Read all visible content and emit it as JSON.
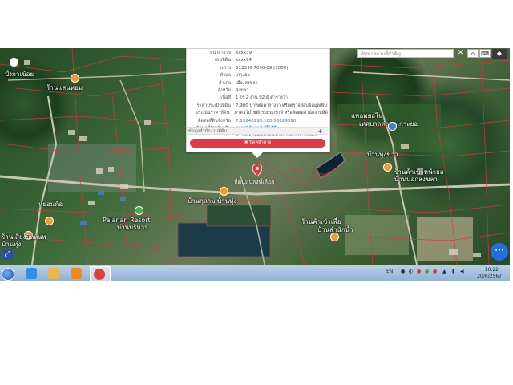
{
  "popup": {
    "rows": [
      {
        "label": "หน้าสำรวจ",
        "value": "xxxx39",
        "link": false
      },
      {
        "label": "เลขที่ดิน",
        "value": "xxxx94",
        "link": false
      },
      {
        "label": "ระวาง",
        "value": "5123 III 7090-09 (1000)",
        "link": false
      },
      {
        "label": "ตำบล",
        "value": "เกาะยอ",
        "link": false
      },
      {
        "label": "อำเภอ",
        "value": "เมืองสงขลา",
        "link": false
      },
      {
        "label": "จังหวัด",
        "value": "สงขลา",
        "link": false
      },
      {
        "label": "เนื้อที่",
        "value": "1 ไร่ 2 งาน 92.6 ตารางวา",
        "link": false
      },
      {
        "label": "ราคาประเมินที่ดิน",
        "value": "7,900 บาทต่อตารางวา หรือตรวจสอบข้อมูลเพิ่ม",
        "link": false
      },
      {
        "label": "ประเมินราคาที่ดิน",
        "value": "ภาพ เว็บไซต์กรมธนารักษ์ หรือติดต่อสำนักงานที่ดิน",
        "link": false
      },
      {
        "label": "ติดต่อที่ดินจังหวัด",
        "value": "7.15240299,100.53824990",
        "link": true
      },
      {
        "label": "ข้อมูลที่ดินเพิ่มเติม",
        "value": "ตรวจที่ดินแปลงนี้ได้ที่",
        "link": true
      },
      {
        "label": "",
        "value": "ตรวจสอบที่ตั้งแปลงที่ดินแบบสำนักงานที่ดิน",
        "link": true
      }
    ],
    "more_label": "ข้อมูลสำนักงานที่ดิน",
    "more_icon": "+",
    "close_label": "✖ ปิดหน้าต่าง"
  },
  "search": {
    "placeholder": "ค้นหาสถานที่สำคัญ",
    "close_icon": "✕",
    "home_icon": "⌂",
    "keyboard_icon": "⌨",
    "layers_icon": "◆"
  },
  "map_labels": [
    {
      "text": "ปั่งกาเข้อย"
    },
    {
      "text": "ร้านแสนหอม"
    },
    {
      "text": "แหลมยอไน"
    },
    {
      "text": "บ้านสำนักน้ำ"
    },
    {
      "text": "บ้านทุ่ง"
    },
    {
      "text": "ร้านค้าเข้าเพื่อ"
    },
    {
      "text": "หย่อมด้อ"
    },
    {
      "text": "ร้านเสียงบิณณพ"
    },
    {
      "text": "บ้านกุลาม บ้านทุ่ง"
    },
    {
      "text": "Palanan Resort"
    },
    {
      "text": "บ้านบริหาร"
    },
    {
      "text": "เทศบาลตำบลเกาะยอ"
    },
    {
      "text": "บ้านทุ่งขาว"
    },
    {
      "text": "ร้านค้าเข้าหน้ายอ"
    },
    {
      "text": "บ้านนอกสงขลา"
    }
  ],
  "marker_label": "ที่ดินแปลงที่เลือก",
  "fab_icon": "···",
  "cursor_tool_icon": "⤢",
  "taskbar": {
    "apps": [
      {
        "name": "ie",
        "color": "#2f8fe0"
      },
      {
        "name": "explorer",
        "color": "#e8b84a"
      },
      {
        "name": "media",
        "color": "#f08a1c"
      },
      {
        "name": "chrome",
        "color": "#d9433b"
      }
    ],
    "lang": "EN",
    "time": "10:22",
    "date": "20/6/2567"
  }
}
